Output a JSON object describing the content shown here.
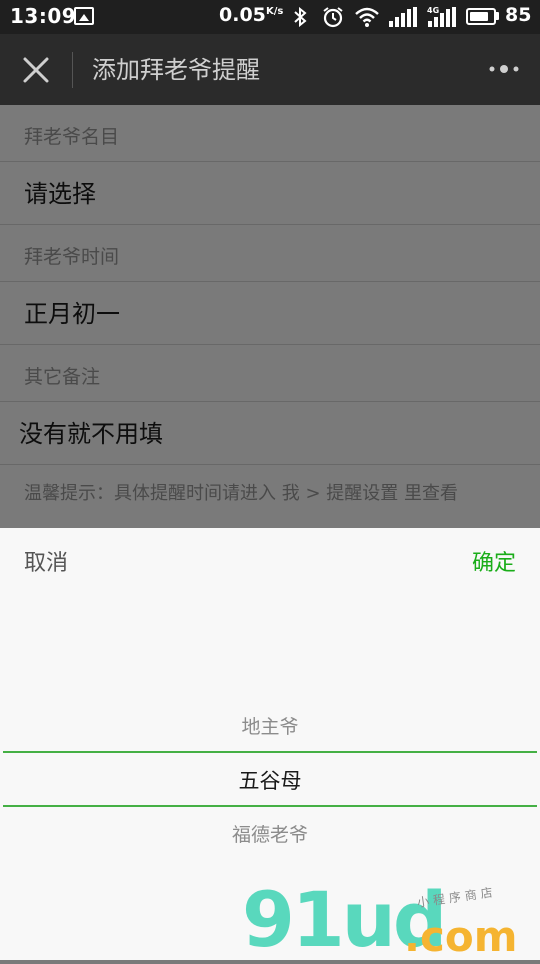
{
  "status_bar": {
    "time": "13:09",
    "speed": "0.05",
    "speed_unit": "K/s",
    "network_type": "4G",
    "battery": "85",
    "battery_level": 0.85,
    "icons": [
      "picture-icon",
      "bluetooth-icon",
      "alarm-icon",
      "wifi-icon",
      "signal-icon",
      "signal-4g-icon",
      "battery-icon"
    ]
  },
  "nav": {
    "title": "添加拜老爷提醒",
    "icons": [
      "close-icon",
      "more-icon"
    ]
  },
  "form": {
    "name_label": "拜老爷名目",
    "name_value": "请选择",
    "time_label": "拜老爷时间",
    "time_value": "正月初一",
    "note_label": "其它备注",
    "note_placeholder": "没有就不用填",
    "hint": "温馨提示：具体提醒时间请进入 我 > 提醒设置 里查看"
  },
  "picker": {
    "cancel": "取消",
    "confirm": "确定",
    "options": [
      "地主爷",
      "五谷母",
      "福德老爷"
    ],
    "selected": "五谷母"
  },
  "watermark": {
    "logo": "91ud",
    "domain": ".com",
    "subtitle": "小程序商店"
  },
  "colors": {
    "accent": "#1aad19",
    "picker_line": "#45b045",
    "nav_bg": "#2b2b2b",
    "status_bg": "#1f1f1f",
    "overlay_bg": "#7a7a7a",
    "sheet_bg": "#f8f8f8"
  }
}
